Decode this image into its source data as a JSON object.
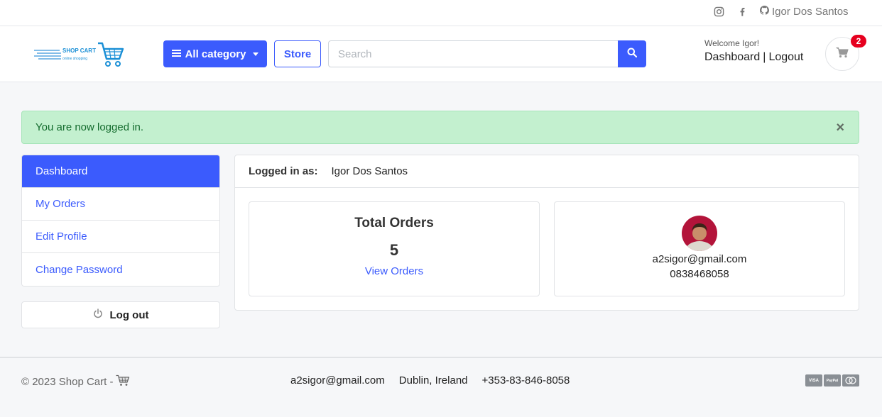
{
  "topbar": {
    "icons": [
      "instagram-icon",
      "facebook-icon",
      "github-icon"
    ],
    "user_name": "Igor Dos Santos"
  },
  "header": {
    "logo_text": "SHOP CART",
    "logo_subtext": "online shopping",
    "category_label": "All category",
    "store_label": "Store",
    "search_placeholder": "Search",
    "search_value": "",
    "welcome": "Welcome Igor!",
    "dashboard_link": "Dashboard",
    "separator": "|",
    "logout_link": "Logout",
    "cart_count": "2"
  },
  "alert": {
    "message": "You are now logged in.",
    "close": "×"
  },
  "sidebar": {
    "items": [
      {
        "label": "Dashboard",
        "active": true
      },
      {
        "label": "My Orders",
        "active": false
      },
      {
        "label": "Edit Profile",
        "active": false
      },
      {
        "label": "Change Password",
        "active": false
      }
    ],
    "logout_label": "Log out"
  },
  "main": {
    "logged_in_label": "Logged in as:",
    "user_name": "Igor Dos Santos",
    "orders": {
      "title": "Total Orders",
      "count": "5",
      "link": "View Orders"
    },
    "profile": {
      "email": "a2sigor@gmail.com",
      "phone": "0838468058"
    }
  },
  "footer": {
    "copyright": "© 2023 Shop Cart -",
    "email": "a2sigor@gmail.com",
    "location": "Dublin, Ireland",
    "phone": "+353-83-846-8058",
    "payments": [
      "VISA",
      "PayPal",
      "MC"
    ]
  },
  "colors": {
    "primary": "#3b5bfd",
    "alert_bg": "#c3f0cf",
    "badge": "#e6001f"
  }
}
